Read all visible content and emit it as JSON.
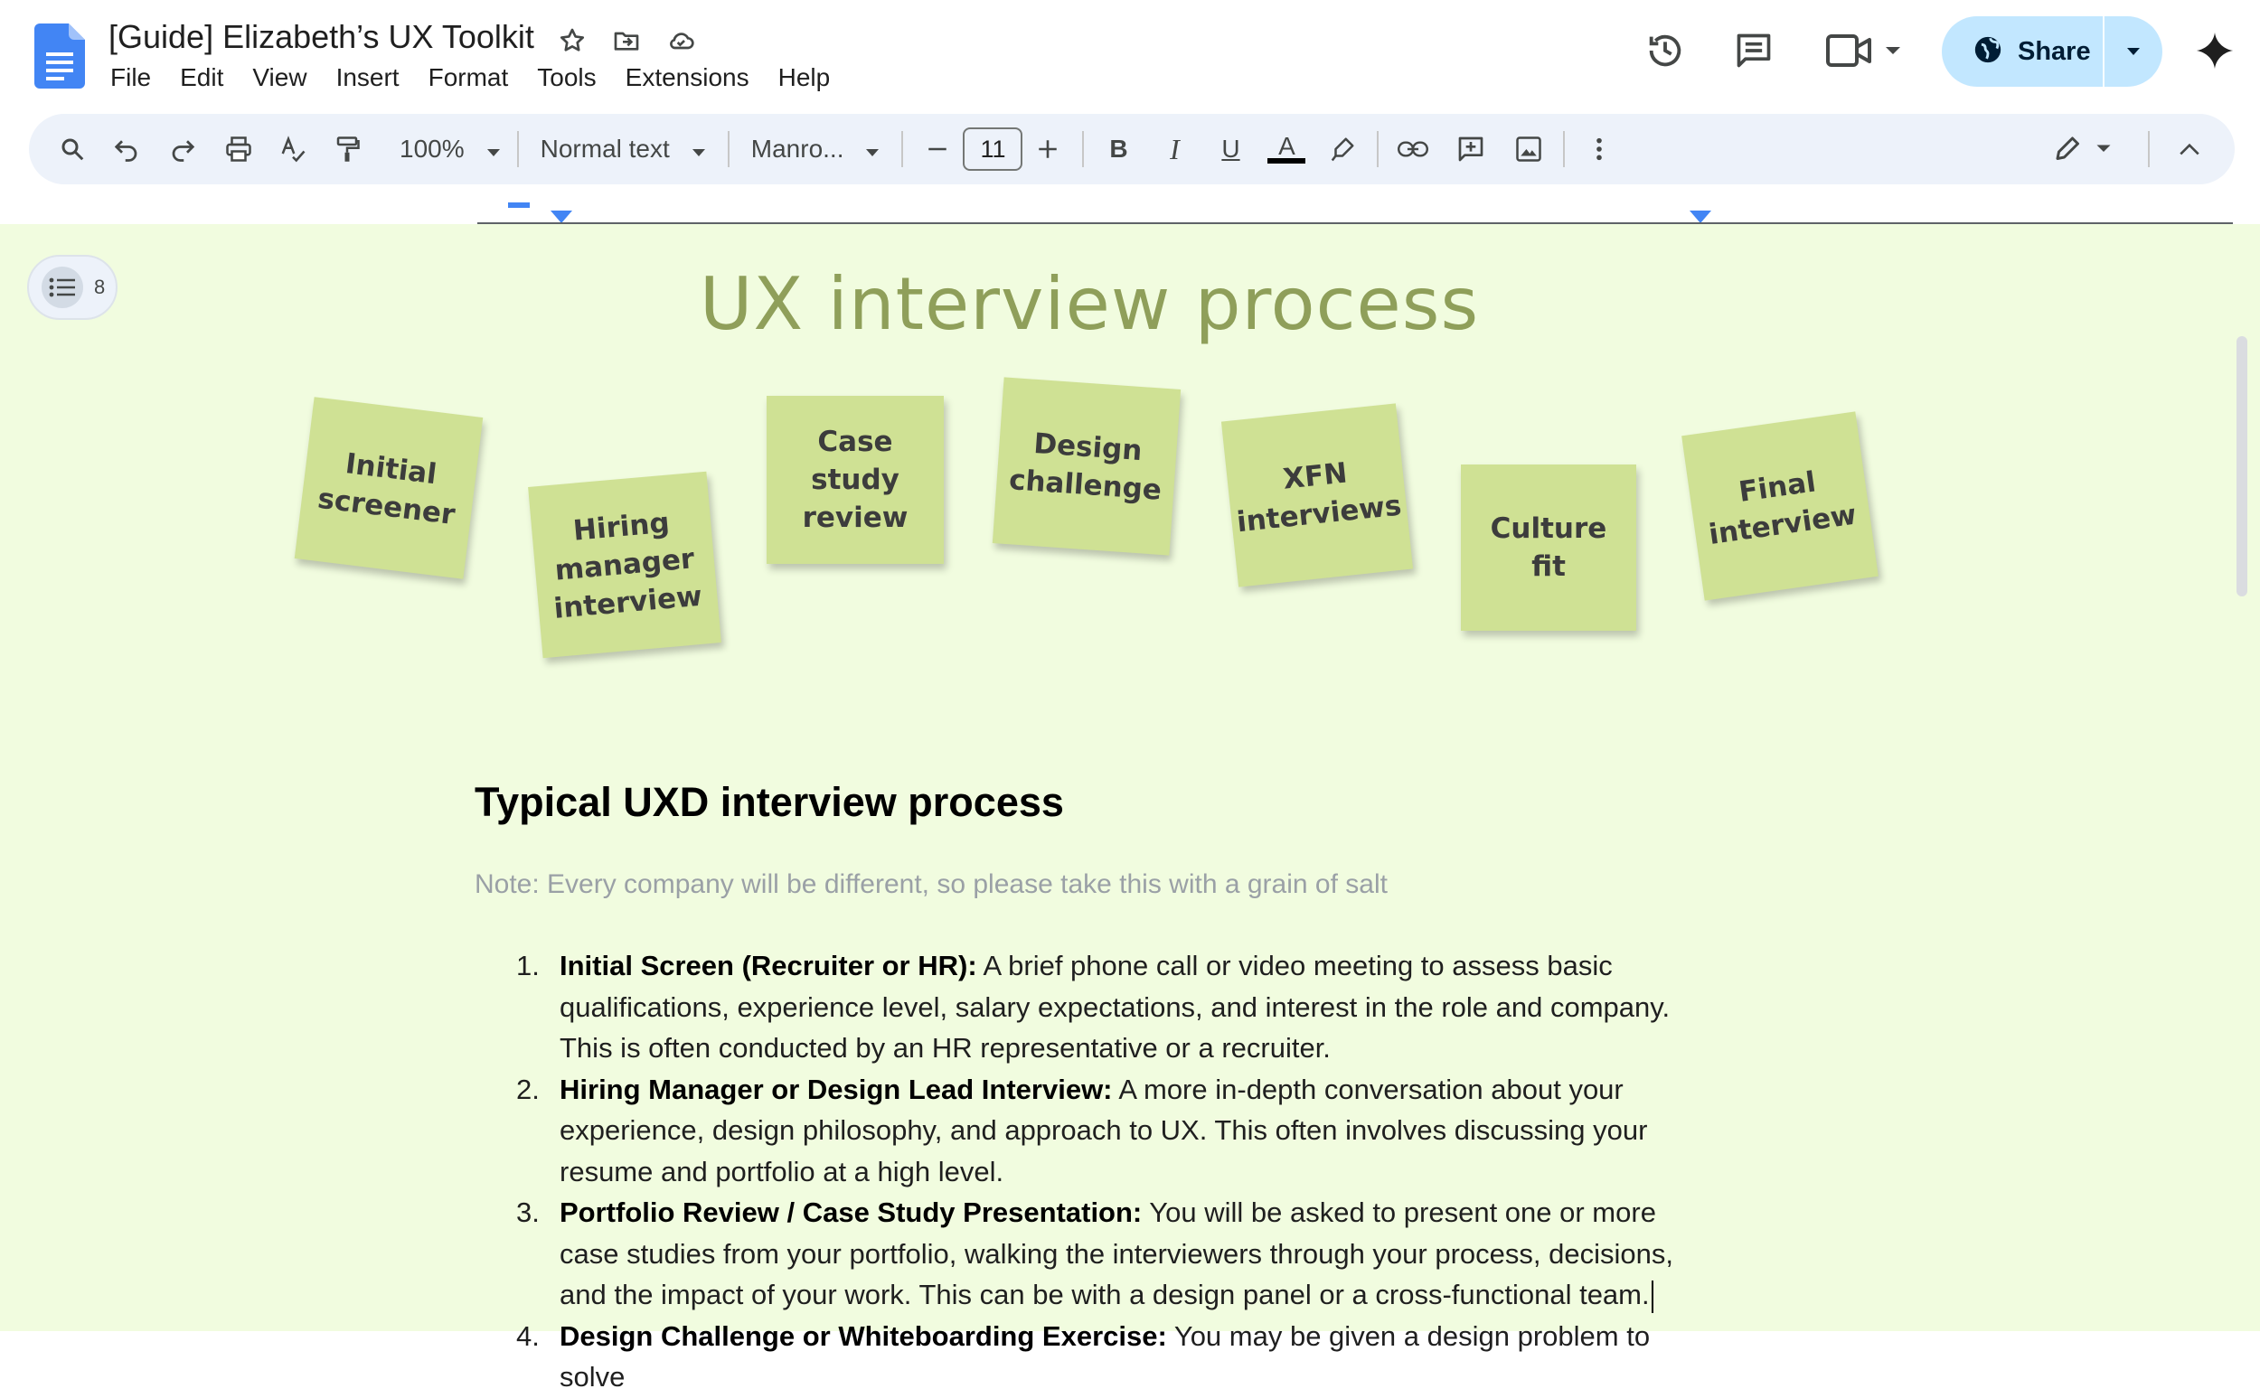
{
  "header": {
    "title": "[Guide] Elizabeth’s UX Toolkit",
    "menu": [
      "File",
      "Edit",
      "View",
      "Insert",
      "Format",
      "Tools",
      "Extensions",
      "Help"
    ],
    "share_label": "Share",
    "accent_color": "#c2e7ff"
  },
  "toolbar": {
    "zoom": "100%",
    "style": "Normal text",
    "font": "Manro...",
    "font_size": "11",
    "bold_label": "B",
    "italic_label": "I",
    "underline_label": "U",
    "text_color_label": "A"
  },
  "outline": {
    "count": "8"
  },
  "document": {
    "background_color": "#f1fcdf",
    "process_title": "UX interview process",
    "stickies": [
      "Initial\nscreener",
      "Hiring\nmanager\ninterview",
      "Case\nstudy\nreview",
      "Design\nchallenge",
      "XFN\ninterviews",
      "Culture\nfit",
      "Final\ninterview"
    ],
    "heading": "Typical UXD interview process",
    "note": "Note: Every company will be different, so please take this with a grain of salt",
    "list": [
      {
        "num": "1.",
        "bold": "Initial Screen (Recruiter or HR):",
        "text": " A brief phone call or video meeting to assess basic qualifications, experience level, salary expectations, and interest in the role and company. This is often conducted by an HR representative or a recruiter."
      },
      {
        "num": "2.",
        "bold": "Hiring Manager or Design Lead Interview:",
        "text": " A more in-depth conversation about your experience, design philosophy, and approach to UX. This often involves discussing your resume and portfolio at a high level."
      },
      {
        "num": "3.",
        "bold": "Portfolio Review / Case Study Presentation:",
        "text": " You will be asked to present one or more case studies from your portfolio, walking the interviewers through your process, decisions, and the impact of your work. This can be with a design panel or a cross-functional team."
      },
      {
        "num": "4.",
        "bold": "Design Challenge or Whiteboarding Exercise:",
        "text": " You may be given a design problem to solve"
      }
    ]
  }
}
